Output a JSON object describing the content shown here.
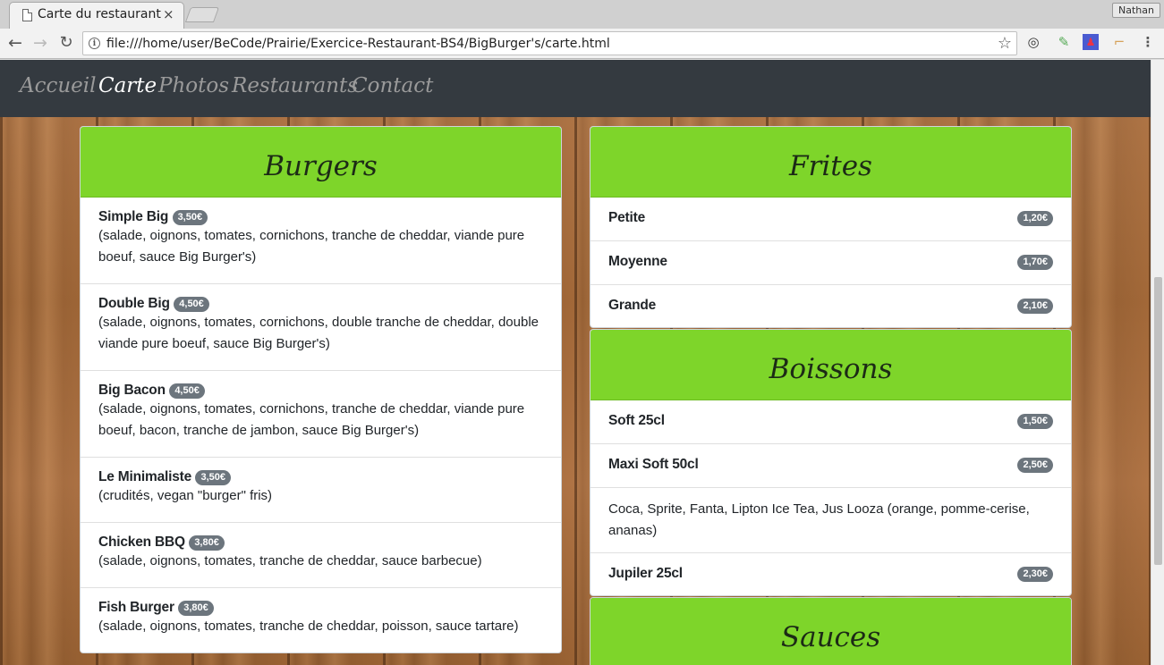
{
  "browser": {
    "tab_title": "Carte du restaurant",
    "tab_close": "×",
    "profile": "Nathan",
    "url": "file:///home/user/BeCode/Prairie/Exercice-Restaurant-BS4/BigBurger's/carte.html",
    "back": "←",
    "forward": "→",
    "reload": "↻",
    "star": "☆",
    "info": "i",
    "menu": "⋮"
  },
  "nav": {
    "links": [
      "Accueil",
      "Carte",
      "Photos",
      "Restaurants",
      "Contact"
    ],
    "active": "Carte"
  },
  "burgers": {
    "title": "Burgers",
    "items": [
      {
        "name": "Simple Big",
        "price": "3,50€",
        "desc": "(salade, oignons, tomates, cornichons, tranche de cheddar, viande pure boeuf, sauce Big Burger's)"
      },
      {
        "name": "Double Big",
        "price": "4,50€",
        "desc": "(salade, oignons, tomates, cornichons, double tranche de cheddar, double viande pure boeuf, sauce Big Burger's)"
      },
      {
        "name": "Big Bacon",
        "price": "4,50€",
        "desc": "(salade, oignons, tomates, cornichons, tranche de cheddar, viande pure boeuf, bacon, tranche de jambon, sauce Big Burger's)"
      },
      {
        "name": "Le Minimaliste",
        "price": "3,50€",
        "desc": "(crudités, vegan \"burger\" fris)"
      },
      {
        "name": "Chicken BBQ",
        "price": "3,80€",
        "desc": "(salade, oignons, tomates, tranche de cheddar, sauce barbecue)"
      },
      {
        "name": "Fish Burger",
        "price": "3,80€",
        "desc": "(salade, oignons, tomates, tranche de cheddar, poisson, sauce tartare)"
      }
    ]
  },
  "frites": {
    "title": "Frites",
    "items": [
      {
        "name": "Petite",
        "price": "1,20€"
      },
      {
        "name": "Moyenne",
        "price": "1,70€"
      },
      {
        "name": "Grande",
        "price": "2,10€"
      }
    ]
  },
  "boissons": {
    "title": "Boissons",
    "items": [
      {
        "name": "Soft 25cl",
        "price": "1,50€"
      },
      {
        "name": "Maxi Soft 50cl",
        "price": "2,50€"
      }
    ],
    "note": "Coca, Sprite, Fanta, Lipton Ice Tea, Jus Looza (orange, pomme-cerise, ananas)",
    "beer": {
      "name": "Jupiler 25cl",
      "price": "2,30€"
    }
  },
  "sauces": {
    "title": "Sauces"
  },
  "colors": {
    "card_header": "#7ed52a",
    "navbar": "#343a40",
    "badge": "#6c757d"
  }
}
